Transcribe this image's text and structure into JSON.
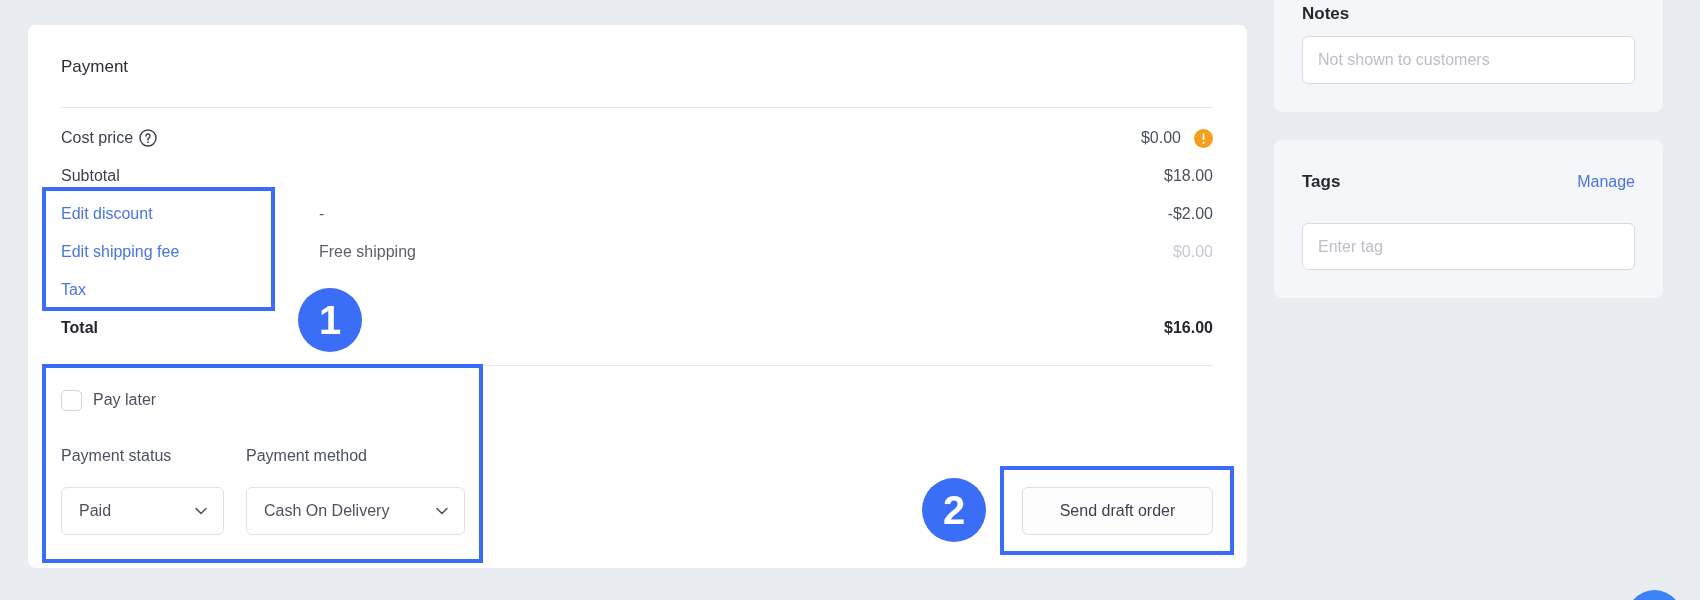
{
  "payment": {
    "title": "Payment",
    "rows": [
      {
        "kind": "cost",
        "label": "Cost price",
        "amount": "$0.00",
        "greyed": false
      },
      {
        "kind": "plain",
        "label": "Subtotal",
        "amount": "$18.00",
        "greyed": false
      },
      {
        "kind": "link",
        "label": "Edit discount",
        "note": "-",
        "amount": "-$2.00",
        "greyed": false
      },
      {
        "kind": "link",
        "label": "Edit shipping fee",
        "note": "Free shipping",
        "amount": "$0.00",
        "greyed": true
      },
      {
        "kind": "link",
        "label": "Tax",
        "greyed": false
      },
      {
        "kind": "total",
        "label": "Total",
        "amount": "$16.00",
        "greyed": false
      }
    ],
    "pay_later": {
      "label": "Pay later",
      "checked": false
    },
    "fields": [
      {
        "label": "Payment status",
        "value": "Paid"
      },
      {
        "label": "Payment method",
        "value": "Cash On Delivery"
      }
    ],
    "send_button": "Send draft order"
  },
  "sidebar": {
    "notes": {
      "title": "Notes",
      "placeholder": "Not shown to customers"
    },
    "tags": {
      "title": "Tags",
      "action": "Manage",
      "placeholder": "Enter tag"
    }
  },
  "annotations": [
    {
      "label": "1"
    },
    {
      "label": "2"
    }
  ]
}
